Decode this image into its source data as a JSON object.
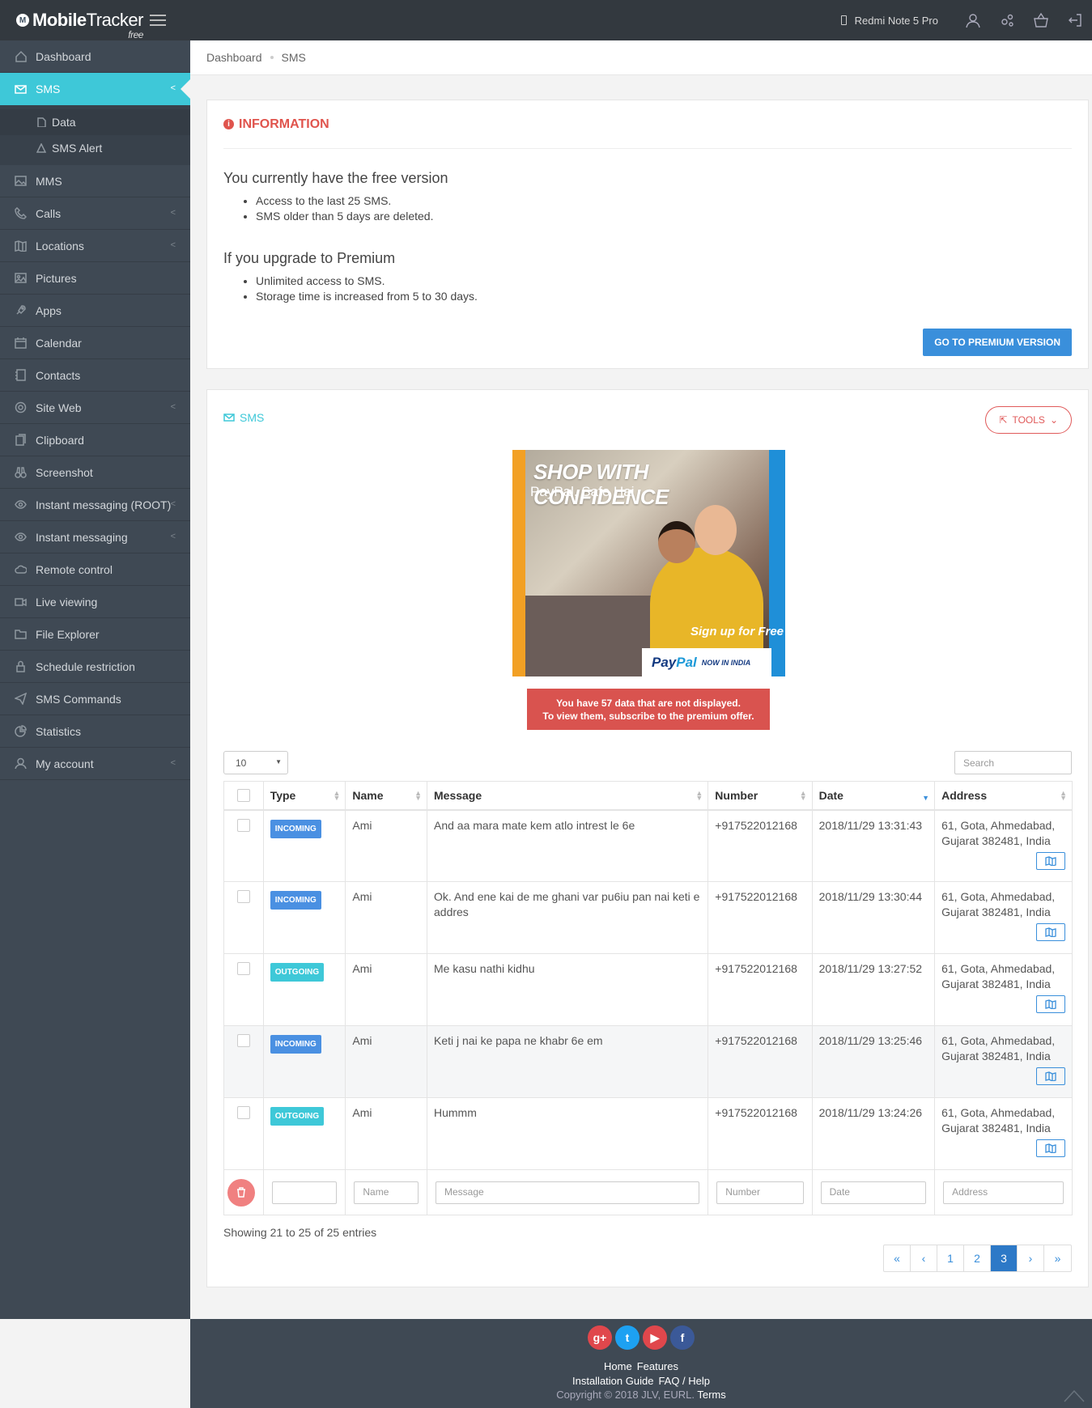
{
  "app": {
    "brand_1": "Mobile",
    "brand_2": "Tracker",
    "free": "free",
    "device": "Redmi Note 5 Pro"
  },
  "sidebar": {
    "items": [
      {
        "label": "Dashboard",
        "icon": "home-icon",
        "chevron": false
      },
      {
        "label": "SMS",
        "icon": "envelope-icon",
        "chevron": true,
        "active": true
      },
      {
        "label": "MMS",
        "icon": "image-icon",
        "chevron": false
      },
      {
        "label": "Calls",
        "icon": "phone-icon",
        "chevron": true
      },
      {
        "label": "Locations",
        "icon": "map-icon",
        "chevron": true
      },
      {
        "label": "Pictures",
        "icon": "picture-icon",
        "chevron": false
      },
      {
        "label": "Apps",
        "icon": "rocket-icon",
        "chevron": false
      },
      {
        "label": "Calendar",
        "icon": "calendar-icon",
        "chevron": false
      },
      {
        "label": "Contacts",
        "icon": "book-icon",
        "chevron": false
      },
      {
        "label": "Site Web",
        "icon": "chrome-icon",
        "chevron": true
      },
      {
        "label": "Clipboard",
        "icon": "clipboard-icon",
        "chevron": false
      },
      {
        "label": "Screenshot",
        "icon": "binoculars-icon",
        "chevron": false
      },
      {
        "label": "Instant messaging (ROOT)",
        "icon": "eye-icon",
        "chevron": true
      },
      {
        "label": "Instant messaging",
        "icon": "eye-icon",
        "chevron": true
      },
      {
        "label": "Remote control",
        "icon": "cloud-icon",
        "chevron": false
      },
      {
        "label": "Live viewing",
        "icon": "video-icon",
        "chevron": false
      },
      {
        "label": "File Explorer",
        "icon": "folder-icon",
        "chevron": false
      },
      {
        "label": "Schedule restriction",
        "icon": "lock-icon",
        "chevron": false
      },
      {
        "label": "SMS Commands",
        "icon": "send-icon",
        "chevron": false
      },
      {
        "label": "Statistics",
        "icon": "pie-chart-icon",
        "chevron": false
      },
      {
        "label": "My account",
        "icon": "user-icon",
        "chevron": true
      }
    ],
    "sms_sub": [
      {
        "label": "Data",
        "icon": "file-icon"
      },
      {
        "label": "SMS Alert",
        "icon": "warning-icon"
      }
    ]
  },
  "breadcrumb": {
    "root": "Dashboard",
    "current": "SMS"
  },
  "info": {
    "title": "INFORMATION",
    "free_heading": "You currently have the free version",
    "free_points": [
      "Access to the last 25 SMS.",
      "SMS older than 5 days are deleted."
    ],
    "premium_heading": "If you upgrade to Premium",
    "premium_points": [
      "Unlimited access to SMS.",
      "Storage time is increased from 5 to 30 days."
    ],
    "button": "GO TO PREMIUM VERSION"
  },
  "sms": {
    "title": "SMS",
    "tools": "TOOLS",
    "ad": {
      "headline": "SHOP WITH CONFIDENCE",
      "sub": "PayPal, Safe Hai",
      "cta": "Sign up for Free",
      "logo_1": "Pay",
      "logo_2": "Pal",
      "logo_note": "NOW IN INDIA"
    },
    "warning_1a": "You have ",
    "warning_1b": "57 data",
    "warning_1c": " that are not displayed.",
    "warning_2": "To view them, subscribe to the premium offer.",
    "page_size": "10",
    "search_placeholder": "Search",
    "columns": [
      "Type",
      "Name",
      "Message",
      "Number",
      "Date",
      "Address"
    ],
    "rows": [
      {
        "type": "INCOMING",
        "name": "Ami",
        "message": "And aa mara mate kem atlo intrest le 6e",
        "number": "+917522012168",
        "date": "2018/11/29 13:31:43",
        "address": "61, Gota, Ahmedabad, Gujarat 382481, India"
      },
      {
        "type": "INCOMING",
        "name": "Ami",
        "message": "Ok. And ene kai de me ghani var pu6iu pan nai keti e addres",
        "number": "+917522012168",
        "date": "2018/11/29 13:30:44",
        "address": "61, Gota, Ahmedabad, Gujarat 382481, India"
      },
      {
        "type": "OUTGOING",
        "name": "Ami",
        "message": "Me kasu nathi kidhu",
        "number": "+917522012168",
        "date": "2018/11/29 13:27:52",
        "address": "61, Gota, Ahmedabad, Gujarat 382481, India"
      },
      {
        "type": "INCOMING",
        "name": "Ami",
        "message": "Keti j nai ke papa ne khabr 6e em",
        "number": "+917522012168",
        "date": "2018/11/29 13:25:46",
        "address": "61, Gota, Ahmedabad, Gujarat 382481, India"
      },
      {
        "type": "OUTGOING",
        "name": "Ami",
        "message": "Hummm",
        "number": "+917522012168",
        "date": "2018/11/29 13:24:26",
        "address": "61, Gota, Ahmedabad, Gujarat 382481, India"
      }
    ],
    "filters": {
      "name": "Name",
      "message": "Message",
      "number": "Number",
      "date": "Date",
      "address": "Address"
    },
    "showing": "Showing 21 to 25 of 25 entries",
    "pager": [
      "«",
      "‹",
      "1",
      "2",
      "3",
      "›",
      "»"
    ],
    "current_page": "3"
  },
  "footer": {
    "links_1": [
      "Home",
      "Features"
    ],
    "links_2": [
      "Installation Guide",
      "FAQ / Help"
    ],
    "copyright": "Copyright © 2018 JLV, EURL.",
    "terms": "Terms",
    "socials": [
      {
        "name": "google-plus-icon",
        "glyph": "g+",
        "color": "#e0474c"
      },
      {
        "name": "twitter-icon",
        "glyph": "t",
        "color": "#1da1f2"
      },
      {
        "name": "youtube-icon",
        "glyph": "▶",
        "color": "#e0474c"
      },
      {
        "name": "facebook-icon",
        "glyph": "f",
        "color": "#3b5998"
      }
    ]
  },
  "colors": {
    "accent": "#3ec8d8",
    "sidebar": "#3f4954",
    "topbar": "#33393f",
    "primary": "#3a8fdb",
    "danger": "#d9534f"
  }
}
